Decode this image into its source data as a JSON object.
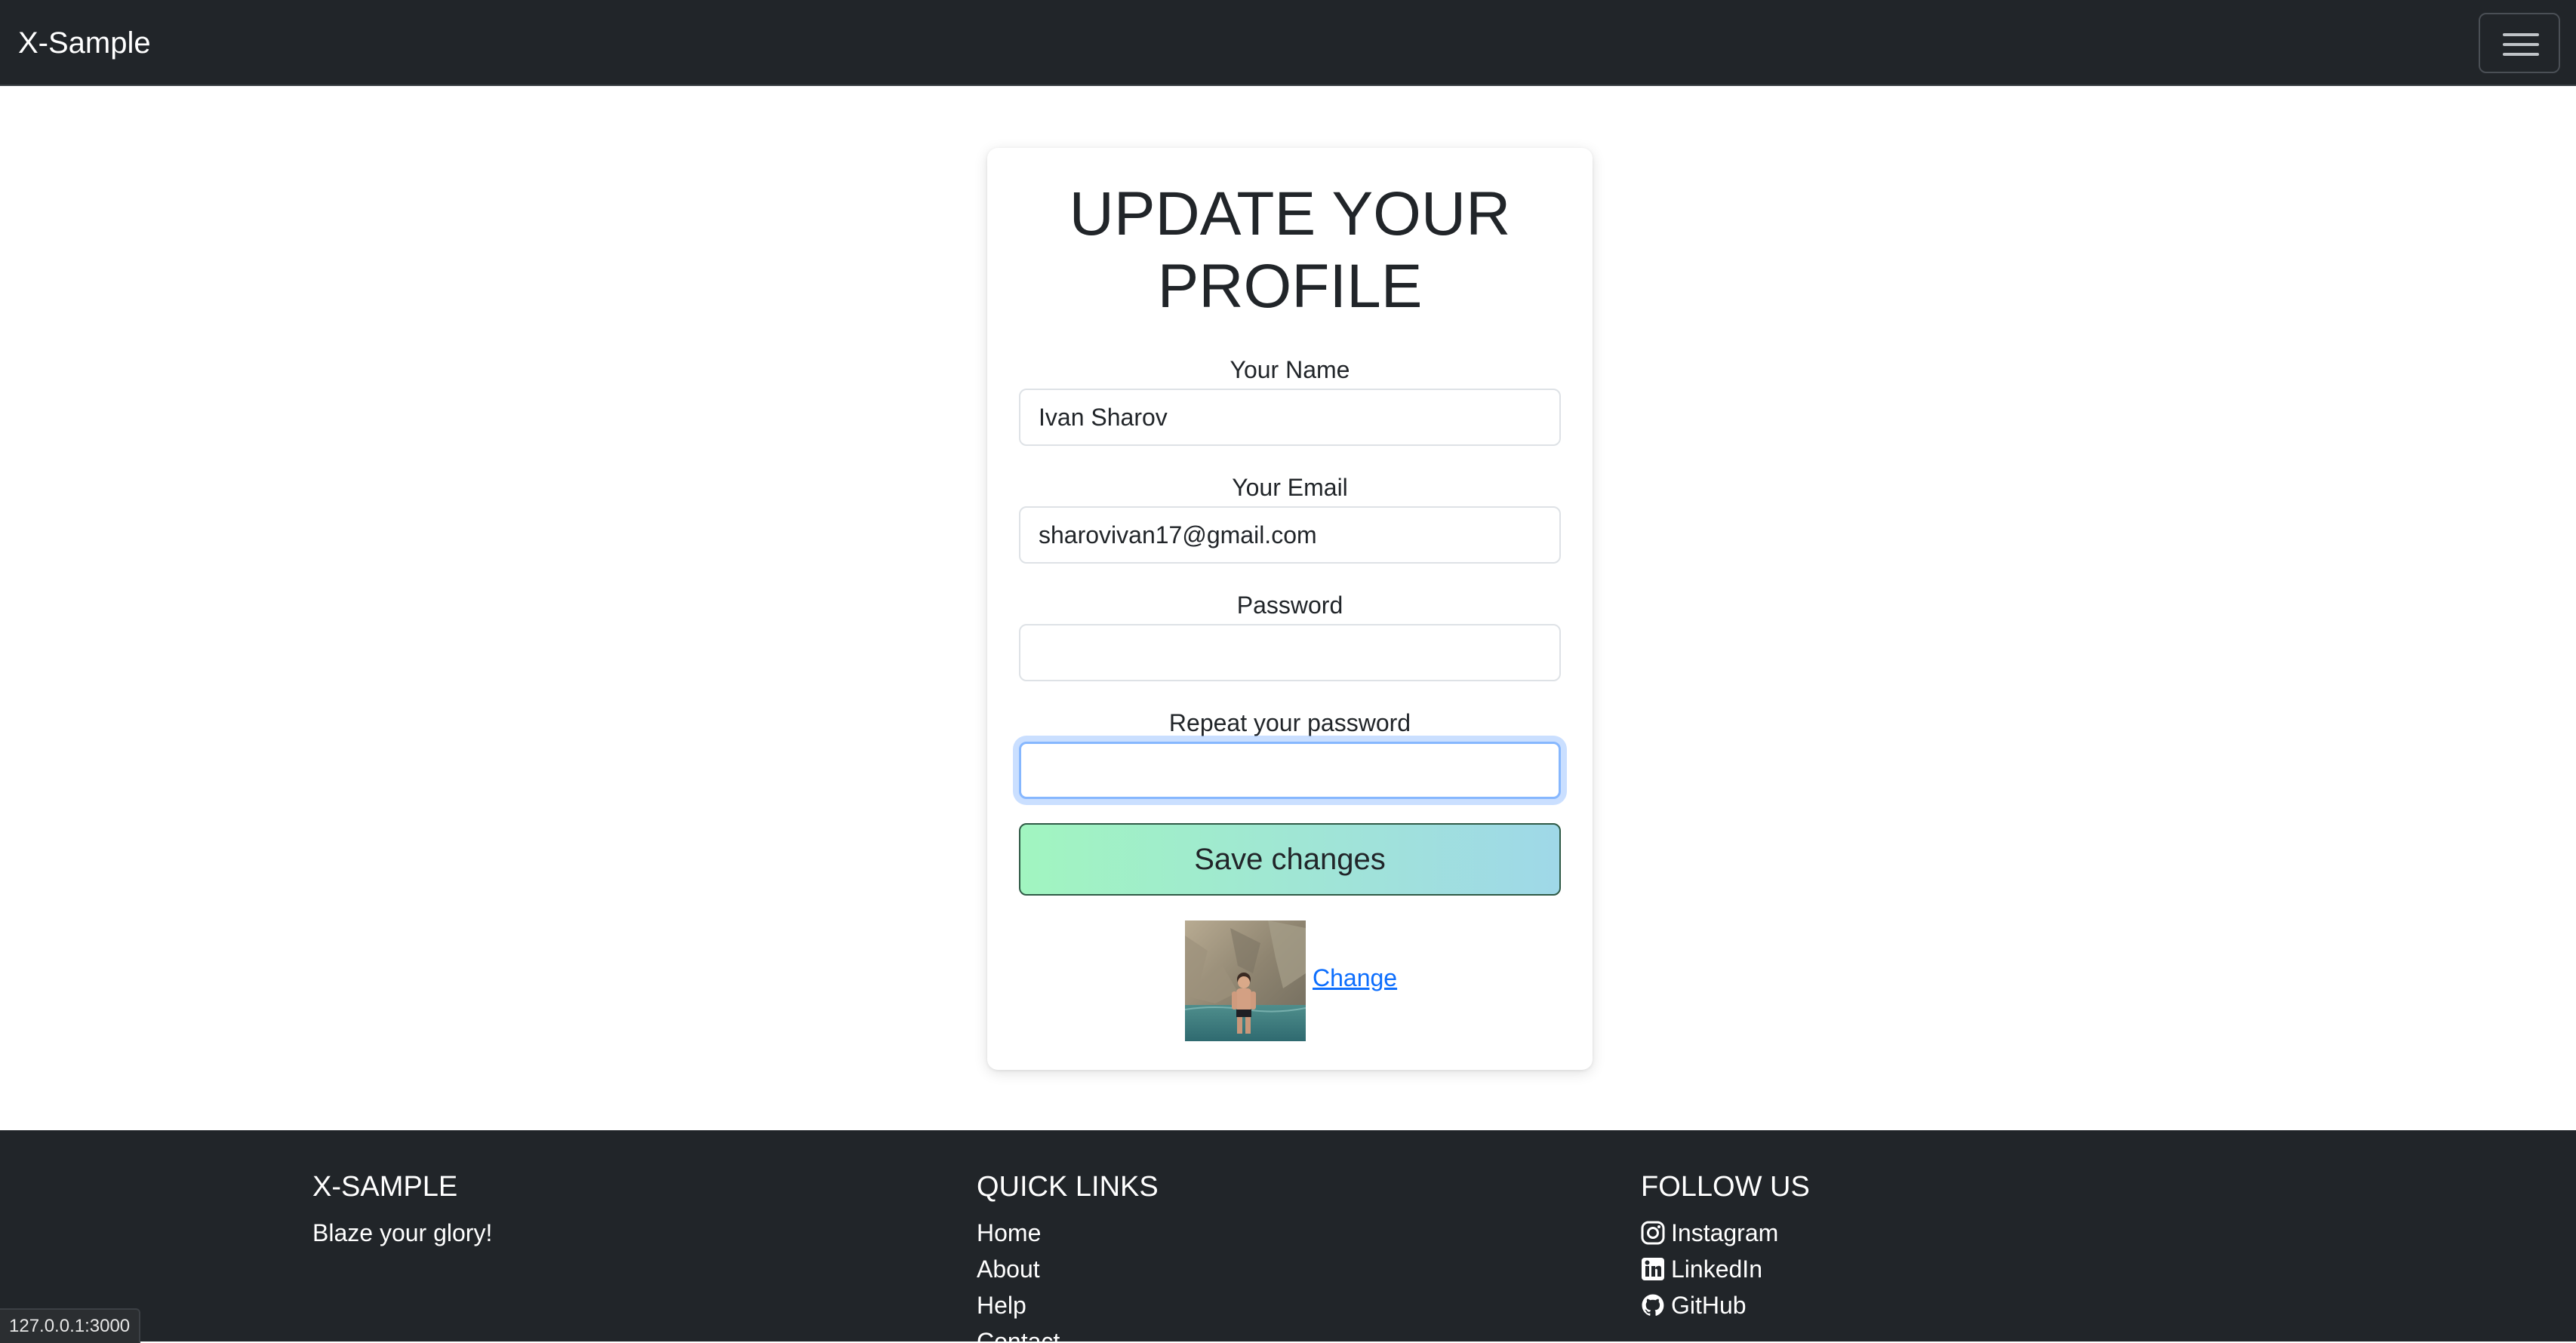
{
  "navbar": {
    "brand": "X-Sample",
    "menu_icon": "hamburger-menu-icon"
  },
  "form": {
    "title_line1": "UPDATE YOUR",
    "title_line2": "PROFILE",
    "name_label": "Your Name",
    "name_value": "Ivan Sharov",
    "email_label": "Your Email",
    "email_value": "sharovivan17@gmail.com",
    "password_label": "Password",
    "password_value": "",
    "repeat_label": "Repeat your password",
    "repeat_value": "",
    "save_label": "Save changes",
    "change_label": "Change"
  },
  "footer": {
    "brand_title": "X-SAMPLE",
    "tagline": "Blaze your glory!",
    "links_title": "QUICK LINKS",
    "links": [
      "Home",
      "About",
      "Help",
      "Contact"
    ],
    "follow_title": "FOLLOW US",
    "social": [
      {
        "label": "Instagram",
        "icon": "instagram-icon"
      },
      {
        "label": "LinkedIn",
        "icon": "linkedin-icon"
      },
      {
        "label": "GitHub",
        "icon": "github-icon"
      }
    ]
  },
  "status_url": "127.0.0.1:3000",
  "colors": {
    "navbar_bg": "#212529",
    "footer_bg": "#212529",
    "link": "#0d6efd",
    "button_gradient_start": "#a1f5c0",
    "button_gradient_end": "#9fd8e8",
    "focus_ring": "#86b7fe"
  }
}
